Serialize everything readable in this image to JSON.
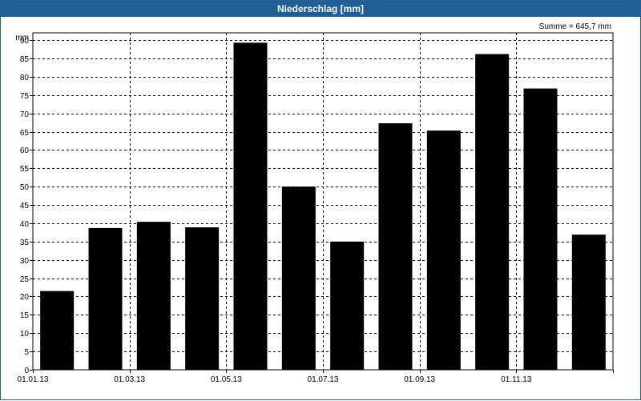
{
  "window": {
    "title": "Niederschlag [mm]"
  },
  "chart_data": {
    "type": "bar",
    "title": "Niederschlag [mm]",
    "ylabel": "mm",
    "annotation": "Summe = 645,7 mm",
    "ylim": [
      0,
      92
    ],
    "yticks": [
      0,
      5,
      10,
      15,
      20,
      25,
      30,
      35,
      40,
      45,
      50,
      55,
      60,
      65,
      70,
      75,
      80,
      85,
      90
    ],
    "xtick_labels": [
      "01.01.13",
      "01.03.13",
      "01.05.13",
      "01.07.13",
      "01.09.13",
      "01.11.13"
    ],
    "categories": [
      "Jan 2013",
      "Feb 2013",
      "Mar 2013",
      "Apr 2013",
      "May 2013",
      "Jun 2013",
      "Jul 2013",
      "Aug 2013",
      "Sep 2013",
      "Oct 2013",
      "Nov 2013",
      "Dec 2013"
    ],
    "values": [
      21.5,
      38.7,
      40.4,
      38.9,
      89.3,
      50.0,
      35.0,
      67.3,
      65.3,
      86.2,
      76.8,
      36.9
    ],
    "colors": {
      "bar": "#000000",
      "grid": "#000000",
      "titlebar": "#1f5f96"
    },
    "grid": true
  }
}
